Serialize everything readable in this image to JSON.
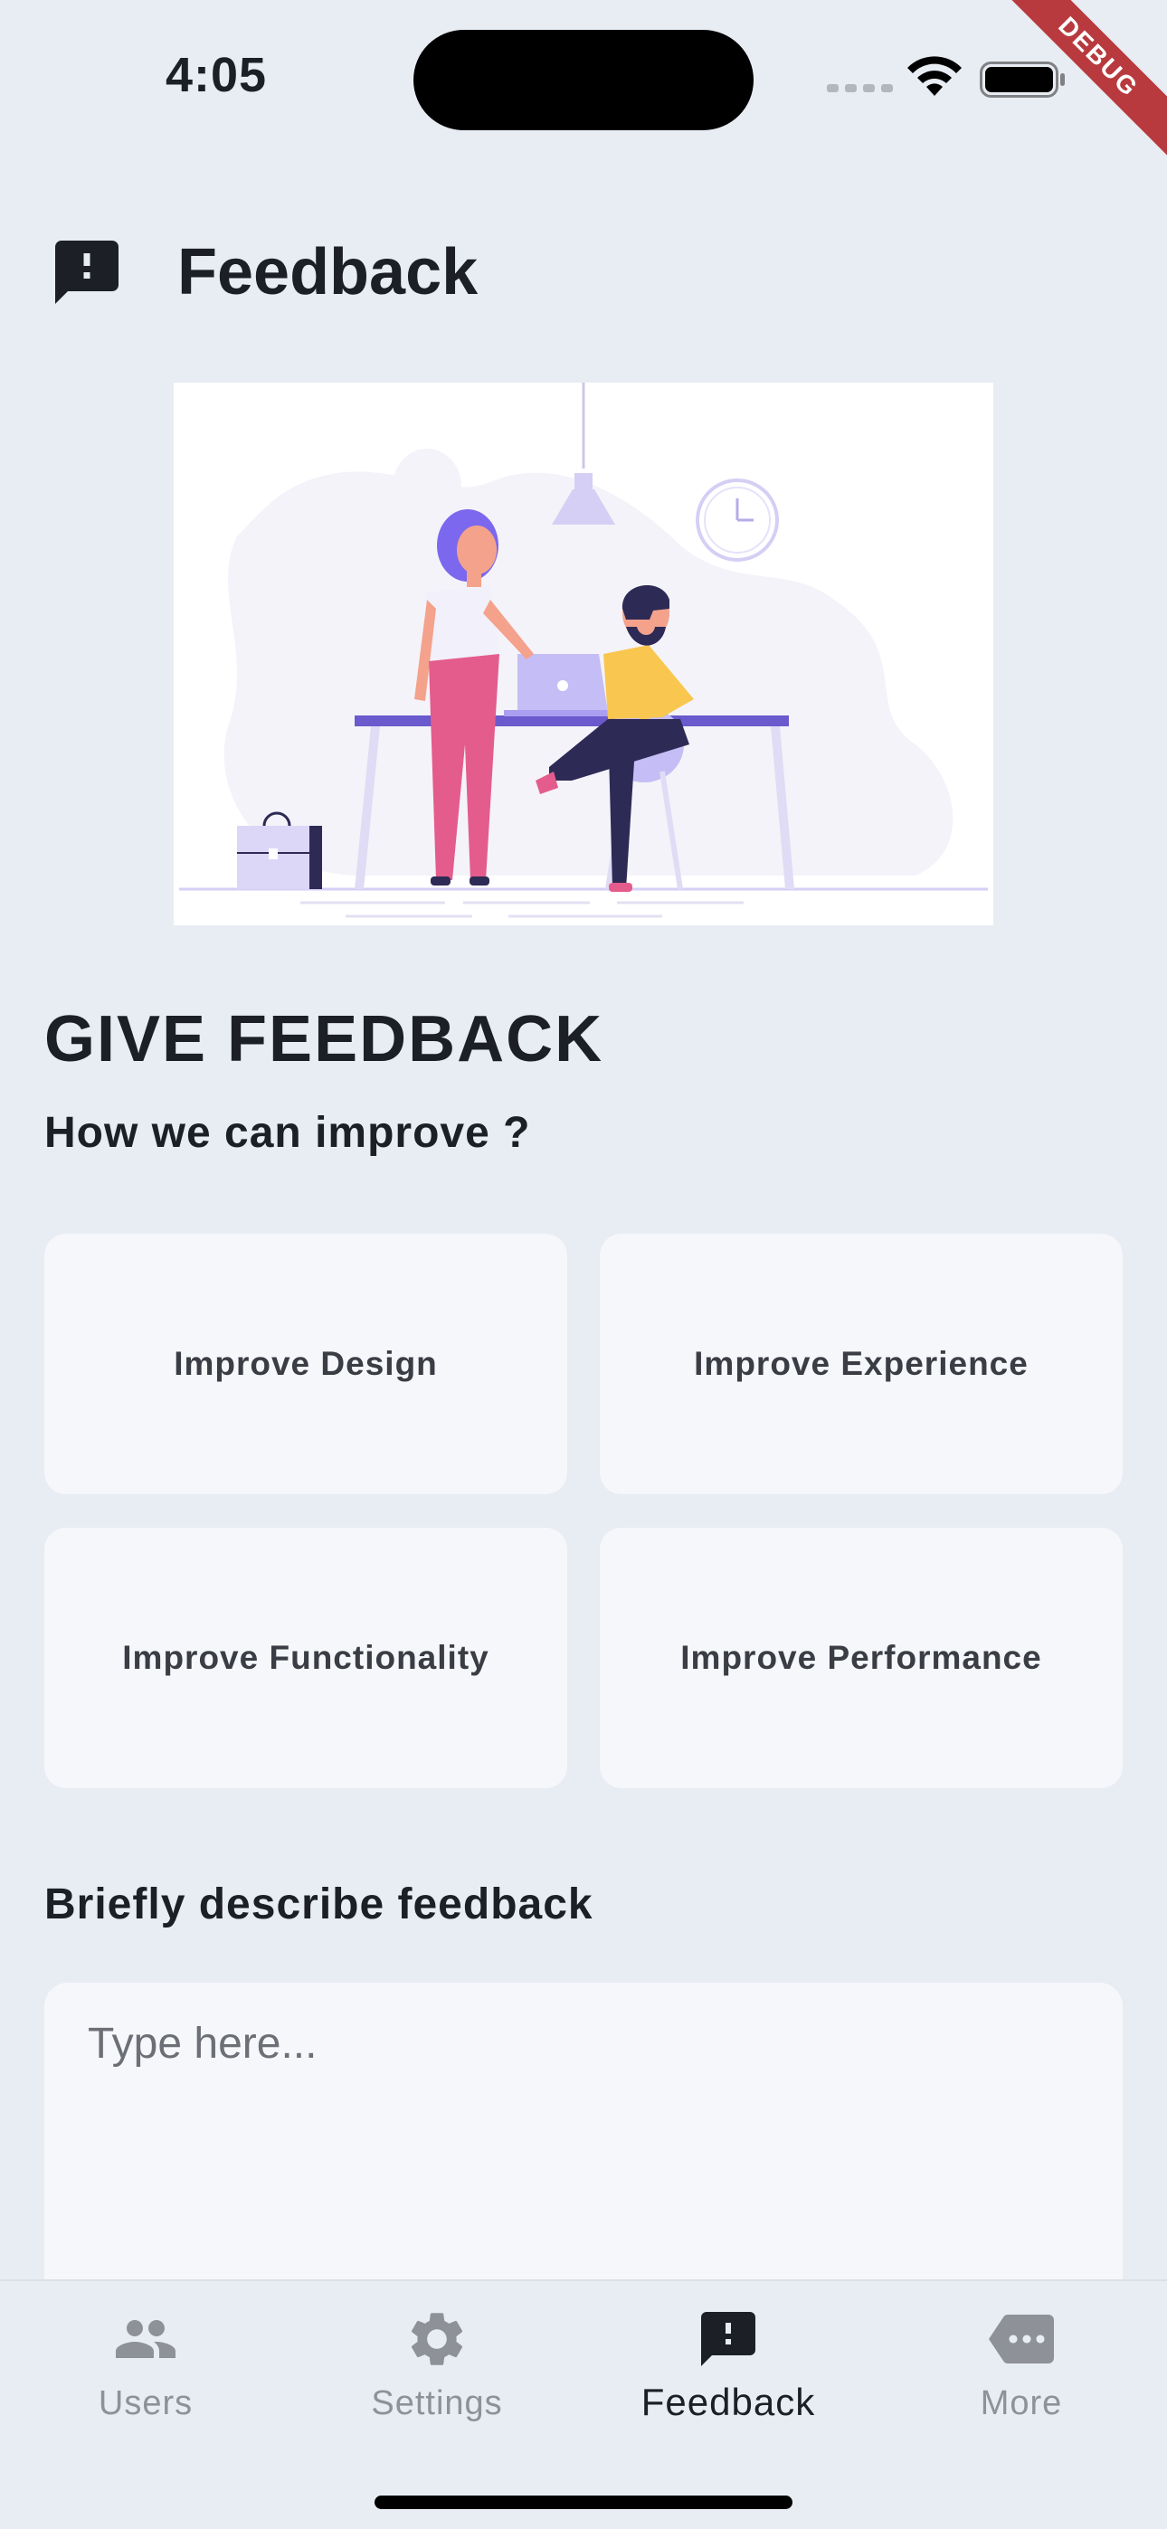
{
  "status_bar": {
    "time": "4:05",
    "debug_label": "DEBUG"
  },
  "header": {
    "title": "Feedback",
    "icon": "feedback-icon"
  },
  "illustration": {
    "subject": "team-working-at-desk-illustration"
  },
  "section": {
    "title": "GIVE FEEDBACK",
    "subtitle": "How we can improve ?"
  },
  "options": [
    {
      "label": "Improve Design"
    },
    {
      "label": "Improve Experience"
    },
    {
      "label": "Improve Functionality"
    },
    {
      "label": "Improve Performance"
    }
  ],
  "describe": {
    "label": "Briefly describe feedback",
    "placeholder": "Type here...",
    "value": ""
  },
  "bottom_nav": {
    "items": [
      {
        "label": "Users",
        "icon": "users-icon",
        "active": false
      },
      {
        "label": "Settings",
        "icon": "gear-icon",
        "active": false
      },
      {
        "label": "Feedback",
        "icon": "feedback-icon",
        "active": true
      },
      {
        "label": "More",
        "icon": "more-icon",
        "active": false
      }
    ]
  },
  "colors": {
    "background": "#e8ecf3",
    "card": "#f6f7fb",
    "text_primary": "#1c1f26",
    "nav_inactive": "#8e9197",
    "accent_purple": "#7b68ee",
    "debug_ribbon": "#b83a3e"
  }
}
